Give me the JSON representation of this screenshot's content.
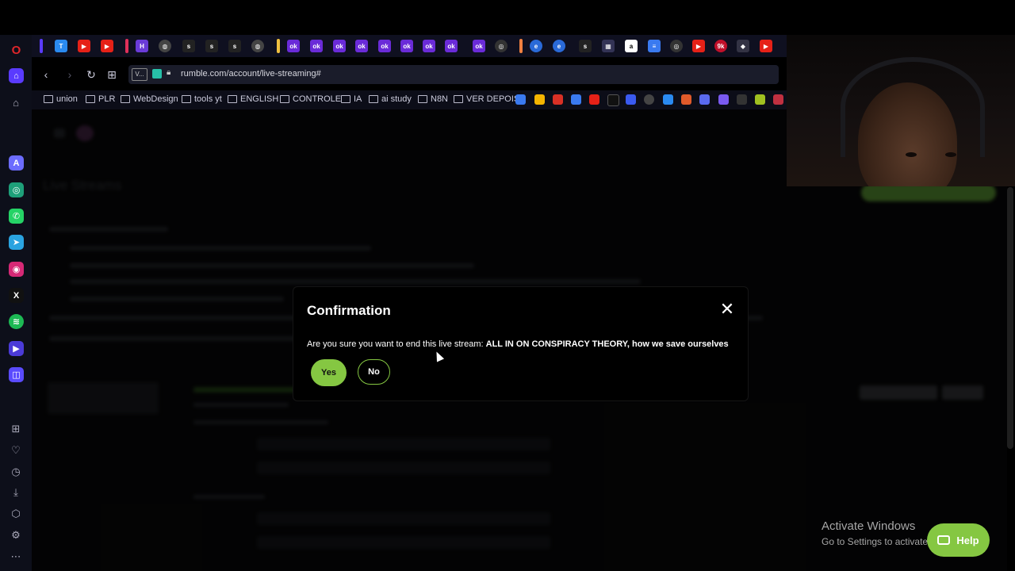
{
  "browser": {
    "url": "rumble.com/account/live-streaming#",
    "tab_label": "V...",
    "bookmarks": [
      "union",
      "PLR",
      "WebDesign",
      "tools yt",
      "ENGLISH",
      "CONTROLE",
      "IA",
      "ai study",
      "N8N",
      "VER DEPOIS"
    ]
  },
  "page": {
    "heading": "Live Streams",
    "stream_title": "ALL IN ON CONSPIRACY THEORY, how we save ourselves"
  },
  "modal": {
    "title": "Confirmation",
    "message_prefix": "Are you sure you want to end this live stream:",
    "stream_name": "ALL IN ON CONSPIRACY THEORY, how we save ourselves",
    "yes_label": "Yes",
    "no_label": "No"
  },
  "watermark": {
    "title": "Activate Windows",
    "subtitle": "Go to Settings to activate"
  },
  "help": {
    "label": "Help"
  },
  "colors": {
    "accent_green": "#85c742",
    "modal_bg": "#000000"
  }
}
